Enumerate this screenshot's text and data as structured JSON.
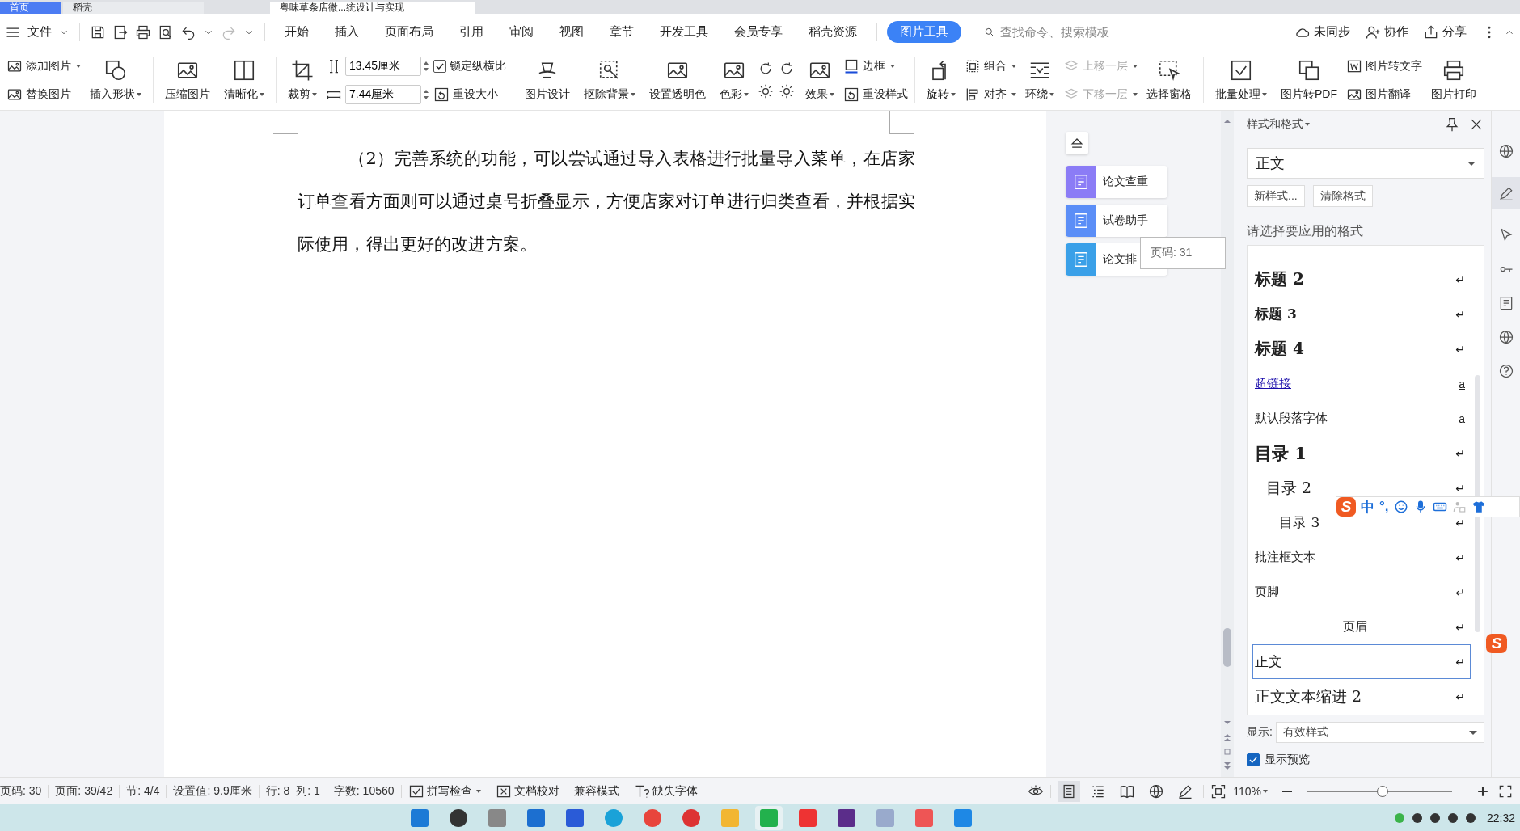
{
  "window_tabs": [
    {
      "label": "首页",
      "selected": false
    },
    {
      "label": "稻壳",
      "selected": false
    },
    {
      "label": "粤味草条店微...统设计与实现",
      "selected": true
    }
  ],
  "menu_bar": {
    "file": "文件",
    "tabs": [
      {
        "label": "开始",
        "selected": false
      },
      {
        "label": "插入",
        "selected": false
      },
      {
        "label": "页面布局",
        "selected": false
      },
      {
        "label": "引用",
        "selected": false
      },
      {
        "label": "审阅",
        "selected": false
      },
      {
        "label": "视图",
        "selected": false
      },
      {
        "label": "章节",
        "selected": false
      },
      {
        "label": "开发工具",
        "selected": false
      },
      {
        "label": "会员专享",
        "selected": false
      },
      {
        "label": "稻壳资源",
        "selected": false
      },
      {
        "label": "图片工具",
        "selected": true
      }
    ],
    "search": {
      "placeholder": "查找命令、搜索模板"
    },
    "actions": [
      "未同步",
      "协作",
      "分享"
    ]
  },
  "ribbon": [
    [
      {
        "kind": "stack",
        "items": [
          {
            "kind": "button",
            "label": "添加图片",
            "dropdown": true,
            "disabled": false
          },
          {
            "kind": "button",
            "label": "替换图片",
            "dropdown": false,
            "disabled": false
          }
        ]
      },
      {
        "kind": "large",
        "label": "插入形状",
        "dropdown": true
      }
    ],
    [
      {
        "kind": "large",
        "label": "压缩图片",
        "dropdown": false
      },
      {
        "kind": "large",
        "label": "清晰化",
        "dropdown": true
      }
    ],
    [
      {
        "kind": "large",
        "label": "裁剪",
        "dropdown": true
      },
      {
        "kind": "fields",
        "values": [
          "13.45厘米",
          "7.44厘米"
        ]
      },
      {
        "kind": "stack",
        "items": [
          {
            "kind": "checkbox",
            "label": "锁定纵横比",
            "checked": true,
            "dropdown": false,
            "disabled": false
          },
          {
            "kind": "button",
            "label": "重设大小",
            "dropdown": false,
            "disabled": false
          }
        ]
      }
    ],
    [
      {
        "kind": "large",
        "label": "图片设计",
        "dropdown": false
      },
      {
        "kind": "large",
        "label": "抠除背景",
        "dropdown": true
      },
      {
        "kind": "large",
        "label": "设置透明色",
        "dropdown": false
      },
      {
        "kind": "large",
        "label": "色彩",
        "dropdown": true
      },
      {
        "kind": "icons"
      },
      {
        "kind": "large",
        "label": "效果",
        "dropdown": true
      },
      {
        "kind": "stack",
        "items": [
          {
            "kind": "button",
            "label": "边框",
            "dropdown": true,
            "disabled": false
          },
          {
            "kind": "button",
            "label": "重设样式",
            "dropdown": false,
            "disabled": false
          }
        ]
      }
    ],
    [
      {
        "kind": "large",
        "label": "旋转",
        "dropdown": true
      },
      {
        "kind": "stack",
        "items": [
          {
            "kind": "button",
            "label": "组合",
            "dropdown": true,
            "disabled": false
          },
          {
            "kind": "button",
            "label": "对齐",
            "dropdown": true,
            "disabled": false
          }
        ]
      },
      {
        "kind": "large",
        "label": "环绕",
        "dropdown": true
      },
      {
        "kind": "stack",
        "items": [
          {
            "kind": "button",
            "label": "上移一层",
            "dropdown": true,
            "disabled": true
          },
          {
            "kind": "button",
            "label": "下移一层",
            "dropdown": true,
            "disabled": true
          }
        ]
      },
      {
        "kind": "large",
        "label": "选择窗格",
        "dropdown": false
      }
    ],
    [
      {
        "kind": "large",
        "label": "批量处理",
        "dropdown": true
      },
      {
        "kind": "large",
        "label": "图片转PDF",
        "dropdown": false
      },
      {
        "kind": "stack",
        "items": [
          {
            "kind": "button",
            "label": "图片转文字",
            "dropdown": false,
            "disabled": false
          },
          {
            "kind": "button",
            "label": "图片翻译",
            "dropdown": false,
            "disabled": false
          }
        ]
      },
      {
        "kind": "large",
        "label": "图片打印",
        "dropdown": false
      }
    ]
  ],
  "document": {
    "paragraph": "（2）完善系统的功能，可以尝试通过导入表格进行批量导入菜单，在店家订单查看方面则可以通过桌号折叠显示，方便店家对订单进行归类查看，并根据实际使用，得出更好的改进方案。"
  },
  "side_tools": [
    "论文查重",
    "试卷助手",
    "论文排"
  ],
  "page_tooltip": "页码: 31",
  "styles_panel": {
    "title": "样式和格式",
    "current": "正文",
    "buttons": [
      "新样式...",
      "清除格式"
    ],
    "prompt": "请选择要应用的格式",
    "styles": [
      {
        "text": "标题 2",
        "kind": "h2",
        "end": "↵",
        "selected": false
      },
      {
        "text": "标题 3",
        "kind": "h3",
        "end": "↵",
        "selected": false
      },
      {
        "text": "标题 4",
        "kind": "h2",
        "end": "↵",
        "selected": false
      },
      {
        "text": "超链接",
        "kind": "link",
        "end": "a",
        "selected": false
      },
      {
        "text": "默认段落字体",
        "kind": "plain",
        "end": "a",
        "selected": false
      },
      {
        "text": "目录 1",
        "kind": "toc1",
        "end": "↵",
        "selected": false
      },
      {
        "text": "目录 2",
        "kind": "toc2",
        "end": "↵",
        "selected": false
      },
      {
        "text": "目录 3",
        "kind": "toc3",
        "end": "↵",
        "selected": false
      },
      {
        "text": "批注框文本",
        "kind": "plain",
        "end": "↵",
        "selected": false
      },
      {
        "text": "页脚",
        "kind": "plain",
        "end": "↵",
        "selected": false
      },
      {
        "text": "页眉",
        "kind": "center",
        "end": "↵",
        "selected": false
      },
      {
        "text": "正文",
        "kind": "body",
        "end": "↵",
        "selected": true
      },
      {
        "text": "正文文本缩进 2",
        "kind": "body-large",
        "end": "↵",
        "selected": false
      }
    ],
    "show_label": "显示:",
    "show_value": "有效样式",
    "preview": {
      "label": "显示预览",
      "checked": true
    }
  },
  "ime_toolbar": {
    "logo": "S",
    "mode": "中",
    "punct": "°,"
  },
  "ime_float": {
    "logo": "S"
  },
  "status_bar": {
    "items": [
      "页码: 30",
      "页面: 39/42",
      "节: 4/4",
      "设置值: 9.9厘米",
      "行: 8",
      "列: 1",
      "字数: 10560"
    ],
    "tools": [
      {
        "label": "拼写检查",
        "dropdown": true
      },
      {
        "label": "文档校对",
        "dropdown": false
      },
      {
        "label": "兼容模式",
        "dropdown": false
      },
      {
        "label": "缺失字体",
        "dropdown": false
      }
    ],
    "view_modes": [
      {
        "selected": true
      },
      {
        "selected": false
      },
      {
        "selected": false
      },
      {
        "selected": false
      },
      {
        "selected": false
      }
    ],
    "zoom": "110%",
    "zoom_slider": {
      "level": 0.52
    }
  },
  "taskbar": {
    "time": "22:32"
  }
}
